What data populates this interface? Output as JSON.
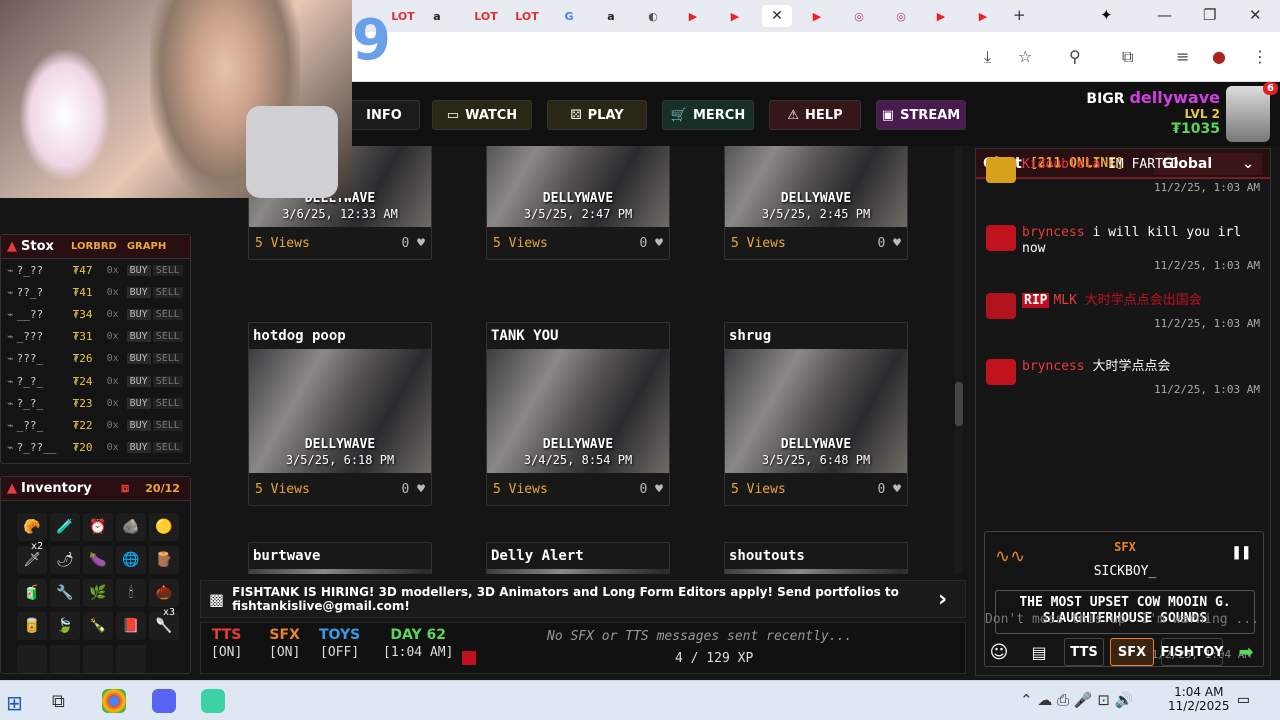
{
  "browser": {
    "tabs": [
      {
        "icon": "lot-icon",
        "label": "LOT",
        "color": "#d33"
      },
      {
        "icon": "amazon-icon",
        "label": "a",
        "color": "#222"
      },
      {
        "icon": "lot-icon",
        "label": "LOT",
        "color": "#d33"
      },
      {
        "icon": "lot-icon",
        "label": "LOT",
        "color": "#d33"
      },
      {
        "icon": "google-icon",
        "label": "G",
        "color": "#4285f4"
      },
      {
        "icon": "amazon-icon",
        "label": "a",
        "color": "#222"
      },
      {
        "icon": "globe-icon",
        "label": "◐",
        "color": "#555"
      },
      {
        "icon": "youtube-icon",
        "label": "▶",
        "color": "#e22"
      },
      {
        "icon": "youtube-icon",
        "label": "▶",
        "color": "#e22"
      },
      {
        "icon": "youtube-icon",
        "label": "▶",
        "color": "#e22"
      },
      {
        "icon": "instagram-icon",
        "label": "◎",
        "color": "#c13584"
      },
      {
        "icon": "instagram-icon",
        "label": "◎",
        "color": "#c13584"
      },
      {
        "icon": "youtube-icon",
        "label": "▶",
        "color": "#e22"
      },
      {
        "icon": "youtube-icon",
        "label": "▶",
        "color": "#e22"
      }
    ],
    "active_tab_close": "✕",
    "new_tab": "+",
    "gemini": "✦",
    "minimize": "—",
    "restore": "❐",
    "close": "✕",
    "toolbar_icons": [
      "⤓",
      "☆",
      "⚲",
      "⧉",
      "≡",
      "●",
      "⋮"
    ]
  },
  "overlay_digit": "9",
  "nav": {
    "info": "INFO",
    "watch": "WATCH",
    "play": "PLAY",
    "merch": "MERCH",
    "help": "HELP",
    "stream": "STREAM"
  },
  "user": {
    "rank": "BIGR",
    "name": "dellywave",
    "level": "LVL 2",
    "coins": "₮1035",
    "badge": "6"
  },
  "stox": {
    "title": "Stox",
    "lorbrd": "LORBRD",
    "graph": "GRAPH",
    "rows": [
      {
        "name": "?_??",
        "price": "₮47",
        "qty": "0x",
        "buy": "BUY",
        "sell": "SELL"
      },
      {
        "name": "??_?",
        "price": "₮41",
        "qty": "0x",
        "buy": "BUY",
        "sell": "SELL"
      },
      {
        "name": "__??",
        "price": "₮34",
        "qty": "0x",
        "buy": "BUY",
        "sell": "SELL"
      },
      {
        "name": "_???",
        "price": "₮31",
        "qty": "0x",
        "buy": "BUY",
        "sell": "SELL"
      },
      {
        "name": "???_",
        "price": "₮26",
        "qty": "0x",
        "buy": "BUY",
        "sell": "SELL"
      },
      {
        "name": "?_?_",
        "price": "₮24",
        "qty": "0x",
        "buy": "BUY",
        "sell": "SELL"
      },
      {
        "name": "?_?_",
        "price": "₮23",
        "qty": "0x",
        "buy": "BUY",
        "sell": "SELL"
      },
      {
        "name": "_??_",
        "price": "₮22",
        "qty": "0x",
        "buy": "BUY",
        "sell": "SELL"
      },
      {
        "name": "?_??__",
        "price": "₮20",
        "qty": "0x",
        "buy": "BUY",
        "sell": "SELL"
      }
    ]
  },
  "inventory": {
    "title": "Inventory",
    "count": "20/12",
    "items": [
      "🥐",
      "🧪",
      "⏰",
      "🪨",
      "🟡",
      "🗡",
      "🌶",
      "🍆",
      "🌐",
      "🪵",
      "🧃",
      "🔧",
      "🌿",
      "🕯",
      "🌰",
      "🥫",
      "🍃",
      "🍾",
      "📕",
      "🥄"
    ],
    "qty_x2": "x2",
    "qty_x3": "x3"
  },
  "clips": [
    {
      "title": "",
      "overlay": "DELLYWAVE",
      "date": "3/6/25, 12:33 AM",
      "views": "5 Views",
      "likes": "0"
    },
    {
      "title": "",
      "overlay": "DELLYWAVE",
      "date": "3/5/25, 2:47 PM",
      "views": "5 Views",
      "likes": "0"
    },
    {
      "title": "",
      "overlay": "DELLYWAVE",
      "date": "3/5/25, 2:45 PM",
      "views": "5 Views",
      "likes": "0"
    },
    {
      "title": "hotdog poop",
      "overlay": "DELLYWAVE",
      "date": "3/5/25, 6:18 PM",
      "views": "5 Views",
      "likes": "0"
    },
    {
      "title": "TANK YOU",
      "overlay": "DELLYWAVE",
      "date": "3/4/25, 8:54 PM",
      "views": "5 Views",
      "likes": "0"
    },
    {
      "title": "shrug",
      "overlay": "DELLYWAVE",
      "date": "3/5/25, 6:48 PM",
      "views": "5 Views",
      "likes": "0"
    },
    {
      "title": "burtwave",
      "overlay": "",
      "date": "",
      "views": "",
      "likes": ""
    },
    {
      "title": "Delly Alert",
      "overlay": "",
      "date": "",
      "views": "",
      "likes": ""
    },
    {
      "title": "shoutouts",
      "overlay": "",
      "date": "",
      "views": "",
      "likes": ""
    }
  ],
  "hiring": {
    "text": "FISHTANK IS HIRING! 3D modellers, 3D Animators and Long Form Editors apply! Send portfolios to fishtankislive@gmail.com!",
    "arrow": "›"
  },
  "status": {
    "tts_label": "TTS",
    "tts_val": "[ON]",
    "sfx_label": "SFX",
    "sfx_val": "[ON]",
    "toys_label": "TOYS",
    "toys_val": "[OFF]",
    "day_label": "DAY 62",
    "day_val": "[1:04 AM]",
    "recent": "No SFX or TTS messages sent recently...",
    "xp": "4 / 129 XP"
  },
  "chat": {
    "title": "Chat",
    "online": "[211 ONLINE]",
    "channel": "Global",
    "messages": [
      {
        "name": "Kidoublela",
        "text": "IM FARTED",
        "time": "11/2/25, 1:03 AM"
      },
      {
        "name": "bryncess",
        "text": "i will kill you irl now",
        "time": "11/2/25, 1:03 AM"
      },
      {
        "name": "MLK",
        "tag": "RIP",
        "text": "大时学点点会出国会",
        "time": "11/2/25, 1:03 AM"
      },
      {
        "name": "bryncess",
        "text": "大时学点点会",
        "time": "11/2/25, 1:03 AM"
      }
    ],
    "sfx": {
      "label": "SFX",
      "user": "SICKBOY_",
      "text": "THE MOST UPSET COW MOOIN G. SLAUGHTERHOUSE SOUNDS",
      "time": "11/2/25, 1:04 AM",
      "pause": "❚❚"
    },
    "placeholder": "Don't mess this up- I'm warning ...",
    "buttons": {
      "tts": "TTS",
      "sfx": "SFX",
      "fishtoy": "FISHTOY"
    }
  },
  "taskbar": {
    "time": "1:04 AM",
    "date": "11/2/2025"
  },
  "colors": {
    "accent_red": "#e83b3b",
    "gold": "#e8c64a",
    "chat_header": "#2a0f12",
    "stream_btn": "#4a1b4f"
  }
}
